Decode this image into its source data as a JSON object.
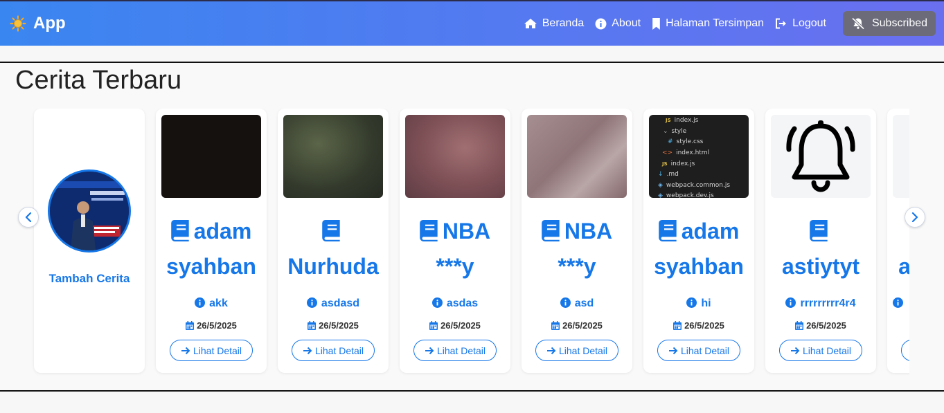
{
  "brand": {
    "name": "App",
    "icon": "sun-icon"
  },
  "nav": {
    "links": [
      {
        "label": "Beranda",
        "icon": "home-icon"
      },
      {
        "label": "About",
        "icon": "info-icon"
      },
      {
        "label": "Halaman Tersimpan",
        "icon": "bookmark-icon"
      },
      {
        "label": "Logout",
        "icon": "logout-icon"
      }
    ],
    "subscribed_label": "Subscribed",
    "subscribed_icon": "bell-slash-icon"
  },
  "stories": {
    "heading": "Cerita Terbaru",
    "add_label": "Tambah Cerita",
    "detail_label": "Lihat Detail",
    "items": [
      {
        "title": "adam syahban",
        "author": "akk",
        "date": "26/5/2025",
        "thumb_color": "#15110f"
      },
      {
        "title": "Nurhuda",
        "author": "asdasd",
        "date": "26/5/2025",
        "thumb_color": "#3a4131"
      },
      {
        "title": "NBA ***y",
        "author": "asdas",
        "date": "26/5/2025",
        "thumb_color": "#8a5a5e"
      },
      {
        "title": "NBA ***y",
        "author": "asd",
        "date": "26/5/2025",
        "thumb_color": "#937f81"
      },
      {
        "title": "adam syahban",
        "author": "hi",
        "date": "26/5/2025",
        "thumb_color": "#1e1e1e"
      },
      {
        "title": "astiytyt",
        "author": "rrrrrrrrr4r4",
        "date": "26/5/2025",
        "thumb_color": "#f4f5f7"
      },
      {
        "title": "a",
        "author": "",
        "date": "",
        "thumb_color": "#f4f5f7"
      }
    ],
    "code_thumb_lines": [
      "index.js",
      "style",
      "style.css",
      "index.html",
      "index.js",
      ".md",
      "webpack.common.js",
      "webpack.dev.js"
    ]
  },
  "colors": {
    "accent": "#1677e8",
    "nav_start": "#3a86f0",
    "nav_end": "#6a6ff0"
  }
}
